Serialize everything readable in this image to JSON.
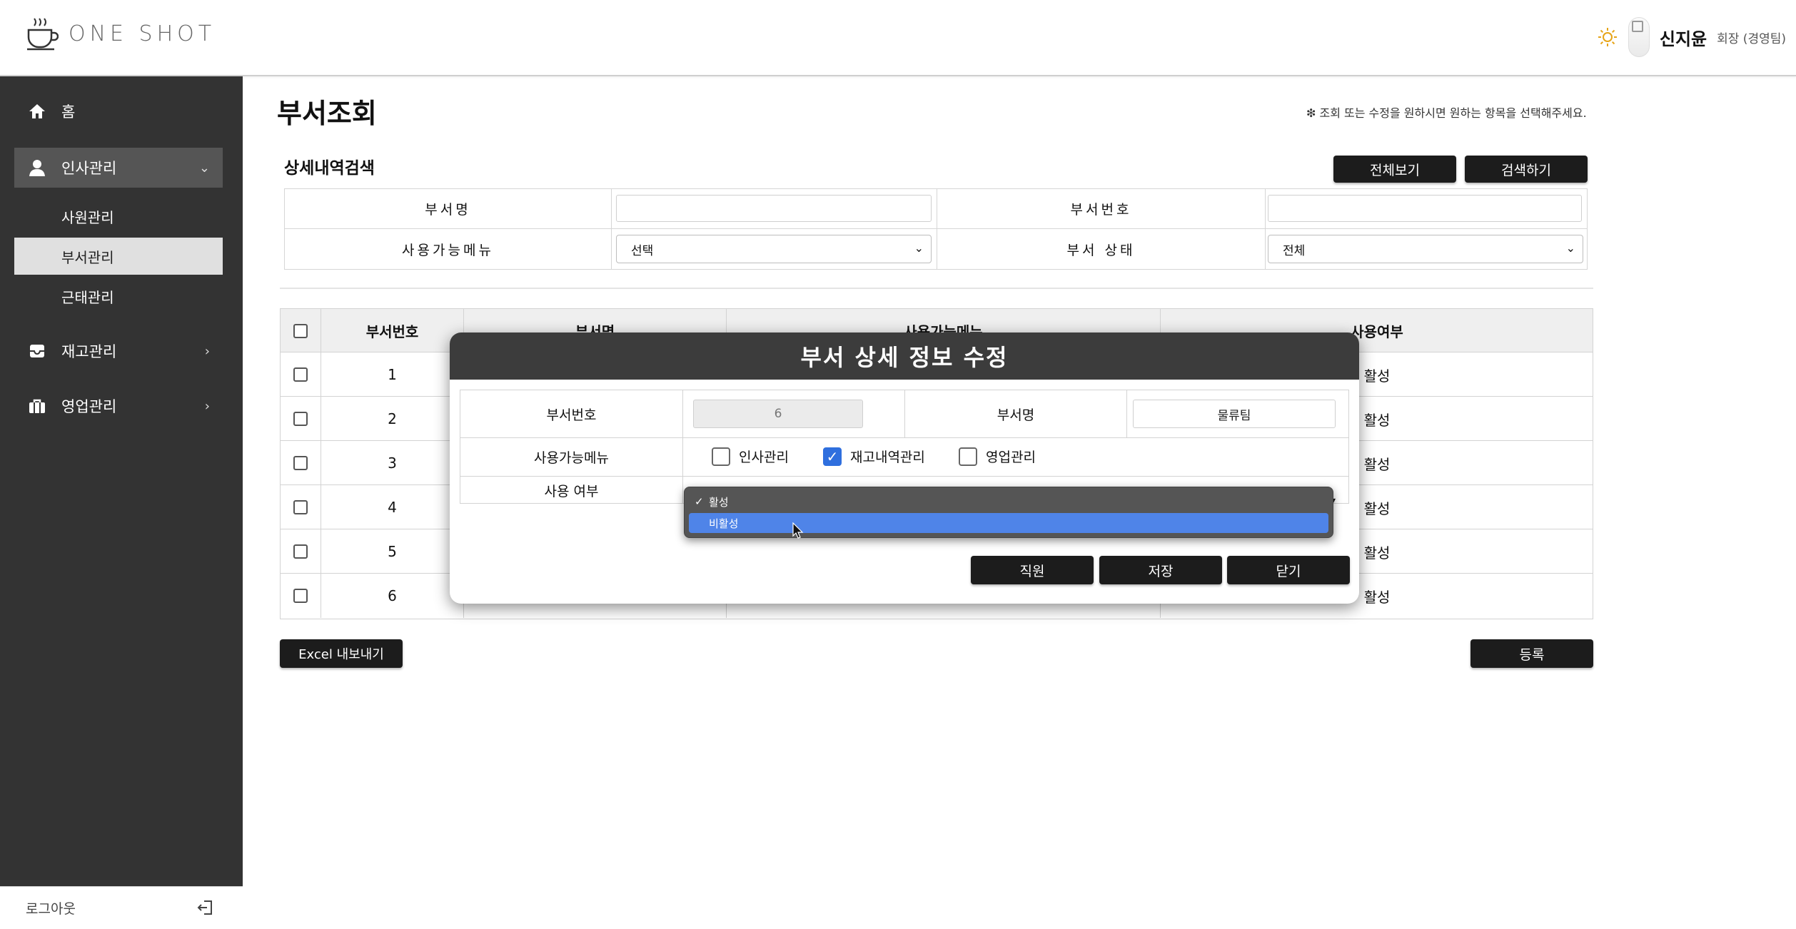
{
  "header": {
    "logo_text": "ONE SHOT",
    "user_name": "신지윤",
    "user_role": "회장 (경영팀)",
    "theme_icon": "sun-icon",
    "avatar_icon": "avatar"
  },
  "sidebar": {
    "home": "홈",
    "hr": "인사관리",
    "hr_sub": [
      "사원관리",
      "부서관리",
      "근태관리"
    ],
    "inventory": "재고관리",
    "sales": "영업관리",
    "logout": "로그아웃"
  },
  "page": {
    "title": "부서조회",
    "hint": "❇ 조회 또는 수정을 원하시면 원하는 항목을 선택해주세요."
  },
  "search": {
    "title": "상세내역검색",
    "view_all": "전체보기",
    "search_btn": "검색하기",
    "label_name": "부서명",
    "label_no": "부서번호",
    "label_menu": "사용가능메뉴",
    "label_status": "부서 상태",
    "menu_select": "선택",
    "status_select": "전체"
  },
  "table": {
    "headers": [
      "부서번호",
      "부서명",
      "사용가능메뉴",
      "사용여부"
    ],
    "rows": [
      {
        "no": "1",
        "status": "활성"
      },
      {
        "no": "2",
        "status": "활성"
      },
      {
        "no": "3",
        "status": "활성"
      },
      {
        "no": "4",
        "status": "활성"
      },
      {
        "no": "5",
        "status": "활성"
      },
      {
        "no": "6",
        "status": "활성"
      }
    ],
    "excel_btn": "Excel 내보내기",
    "register_btn": "등록"
  },
  "modal": {
    "title": "부서 상세 정보 수정",
    "label_no": "부서번호",
    "value_no": "6",
    "label_name": "부서명",
    "value_name": "물류팀",
    "label_menu": "사용가능메뉴",
    "menus": [
      {
        "label": "인사관리",
        "checked": false
      },
      {
        "label": "재고내역관리",
        "checked": true
      },
      {
        "label": "영업관리",
        "checked": false
      }
    ],
    "label_use": "사용 여부",
    "options": [
      "활성",
      "비활성"
    ],
    "selected_option": "활성",
    "hover_option": "비활성",
    "btn_staff": "직원",
    "btn_save": "저장",
    "btn_close": "닫기"
  },
  "colors": {
    "sidebar_bg": "#333333",
    "accent_blue": "#4f84e8",
    "dark_button": "#1c1c1c"
  }
}
